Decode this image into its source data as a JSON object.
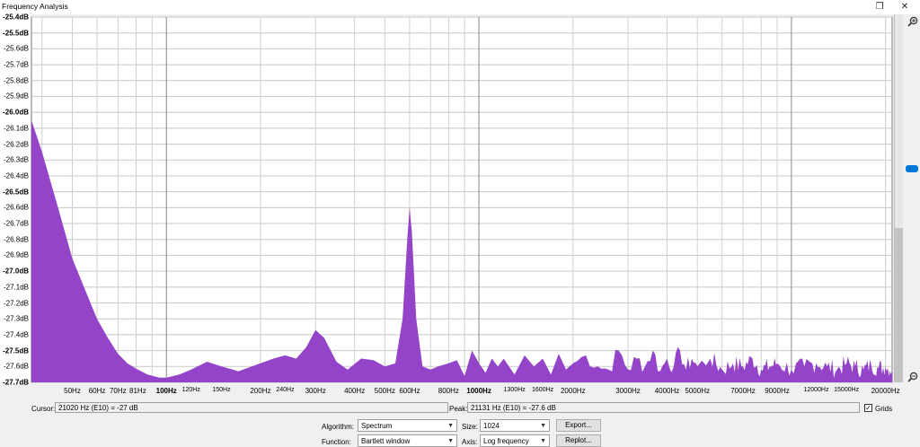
{
  "window": {
    "title": "Frequency Analysis",
    "restore_glyph": "❐",
    "close_glyph": "✕"
  },
  "chart_data": {
    "type": "area",
    "title": "",
    "xscale": "log",
    "xlim": [
      37,
      21000
    ],
    "ylim": [
      -27.7,
      -25.4
    ],
    "grid": true,
    "fill_color": "#9444c8",
    "y_ticks": [
      "-25.4dB",
      "-25.5dB",
      "-25.6dB",
      "-25.7dB",
      "-25.8dB",
      "-25.9dB",
      "-26.0dB",
      "-26.1dB",
      "-26.2dB",
      "-26.3dB",
      "-26.4dB",
      "-26.5dB",
      "-26.6dB",
      "-26.7dB",
      "-26.8dB",
      "-26.9dB",
      "-27.0dB",
      "-27.1dB",
      "-27.2dB",
      "-27.3dB",
      "-27.4dB",
      "-27.5dB",
      "-27.6dB",
      "-27.7dB"
    ],
    "y_tick_values": [
      -25.4,
      -25.5,
      -25.6,
      -25.7,
      -25.8,
      -25.9,
      -26.0,
      -26.1,
      -26.2,
      -26.3,
      -26.4,
      -26.5,
      -26.6,
      -26.7,
      -26.8,
      -26.9,
      -27.0,
      -27.1,
      -27.2,
      -27.3,
      -27.4,
      -27.5,
      -27.6,
      -27.7
    ],
    "y_bold": [
      -25.4,
      -25.5,
      -26.0,
      -26.5,
      -27.0,
      -27.5,
      -27.7
    ],
    "x_ticks": [
      "50Hz",
      "60Hz",
      "70Hz",
      "81Hz",
      "100Hz",
      "120Hz",
      "150Hz",
      "200Hz",
      "240Hz",
      "300Hz",
      "400Hz",
      "500Hz",
      "600Hz",
      "800Hz",
      "1000Hz",
      "1300Hz",
      "1600Hz",
      "2000Hz",
      "3000Hz",
      "4000Hz",
      "5000Hz",
      "7000Hz",
      "9000Hz",
      "12000Hz",
      "15000Hz",
      "20000Hz"
    ],
    "x_tick_values": [
      50,
      60,
      70,
      81,
      100,
      120,
      150,
      200,
      240,
      300,
      400,
      500,
      600,
      800,
      1000,
      1300,
      1600,
      2000,
      3000,
      4000,
      5000,
      7000,
      9000,
      12000,
      15000,
      20000
    ],
    "x_bold": [
      100,
      1000
    ],
    "x": [
      37,
      40,
      45,
      50,
      55,
      60,
      65,
      70,
      75,
      81,
      87,
      95,
      100,
      110,
      120,
      135,
      150,
      170,
      200,
      220,
      240,
      260,
      280,
      300,
      320,
      350,
      380,
      420,
      460,
      500,
      540,
      570,
      590,
      600,
      610,
      630,
      660,
      700,
      740,
      800,
      850,
      900,
      950,
      1000,
      1050,
      1100,
      1150,
      1200,
      1300,
      1400,
      1500,
      1600,
      1700,
      1800,
      1900,
      2000,
      2200,
      2400,
      2600,
      2800,
      3000,
      3200,
      3400,
      3600,
      3800,
      4000,
      4200,
      4400,
      4600,
      4800,
      5000,
      5500,
      6000,
      6500,
      7000,
      7500,
      8000,
      8500,
      9000,
      10000,
      11000,
      12000,
      13000,
      14000,
      15000,
      16000,
      17000,
      18000,
      19000,
      20000,
      21000
    ],
    "y": [
      -26.05,
      -26.25,
      -26.6,
      -26.92,
      -27.12,
      -27.3,
      -27.42,
      -27.52,
      -27.58,
      -27.62,
      -27.65,
      -27.67,
      -27.67,
      -27.65,
      -27.62,
      -27.57,
      -27.6,
      -27.63,
      -27.58,
      -27.55,
      -27.53,
      -27.55,
      -27.48,
      -27.37,
      -27.42,
      -27.57,
      -27.62,
      -27.55,
      -27.56,
      -27.6,
      -27.58,
      -27.3,
      -26.8,
      -26.6,
      -26.75,
      -27.3,
      -27.6,
      -27.62,
      -27.6,
      -27.58,
      -27.56,
      -27.66,
      -27.5,
      -27.58,
      -27.64,
      -27.55,
      -27.6,
      -27.55,
      -27.65,
      -27.53,
      -27.6,
      -27.55,
      -27.65,
      -27.52,
      -27.62,
      -27.58,
      -27.53,
      -27.6,
      -27.62,
      -27.5,
      -27.62,
      -27.55,
      -27.6,
      -27.5,
      -27.63,
      -27.55,
      -27.6,
      -27.5,
      -27.62,
      -27.55,
      -27.6,
      -27.55,
      -27.62,
      -27.58,
      -27.6,
      -27.55,
      -27.62,
      -27.6,
      -27.58,
      -27.62,
      -27.6,
      -27.58,
      -27.6,
      -27.62,
      -27.58,
      -27.6,
      -27.62,
      -27.59,
      -27.61,
      -27.6,
      -27.62
    ]
  },
  "controls": {
    "cursor_label": "Cursor:",
    "cursor_value": "21020 Hz (E10) = -27 dB",
    "peak_label": "Peak:",
    "peak_value": "21131 Hz (E10) = -27.6 dB",
    "grids_label": "Grids",
    "grids_checked": "✓",
    "algorithm_label": "Algorithm:",
    "algorithm_value": "Spectrum",
    "size_label": "Size:",
    "size_value": "1024",
    "export_label": "Export...",
    "function_label": "Function:",
    "function_value": "Bartlett window",
    "axis_label": "Axis:",
    "axis_value": "Log frequency",
    "replot_label": "Replot..."
  },
  "scrollbar": {
    "fill_fraction": 0.42
  },
  "zoom_slider": {
    "level": 0.41
  }
}
